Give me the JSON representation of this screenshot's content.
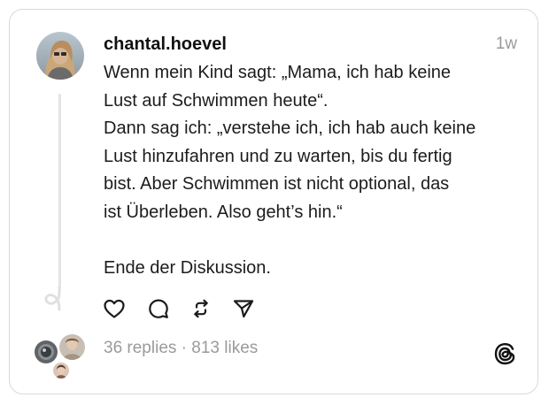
{
  "post": {
    "username": "chantal.hoevel",
    "timestamp": "1w",
    "lines": [
      "Wenn mein Kind sagt: „Mama, ich hab keine",
      "Lust auf Schwimmen heute“.",
      "Dann sag ich: „verstehe ich, ich hab auch keine",
      "Lust hinzufahren und zu warten, bis du fertig",
      "bist. Aber Schwimmen ist nicht optional, das",
      "ist Überleben. Also geht’s hin.“",
      "",
      "Ende der Diskussion."
    ]
  },
  "stats": {
    "replies": "36 replies",
    "separator": " · ",
    "likes": "813 likes"
  },
  "icons": {
    "like": "heart-icon",
    "reply": "comment-icon",
    "repost": "repost-icon",
    "share": "send-icon",
    "brand": "threads-logo-icon"
  },
  "colors": {
    "text": "#1c1c1c",
    "muted": "#9a9a9a",
    "border": "#d9d9d9",
    "thread_line": "#e4e4e4"
  }
}
